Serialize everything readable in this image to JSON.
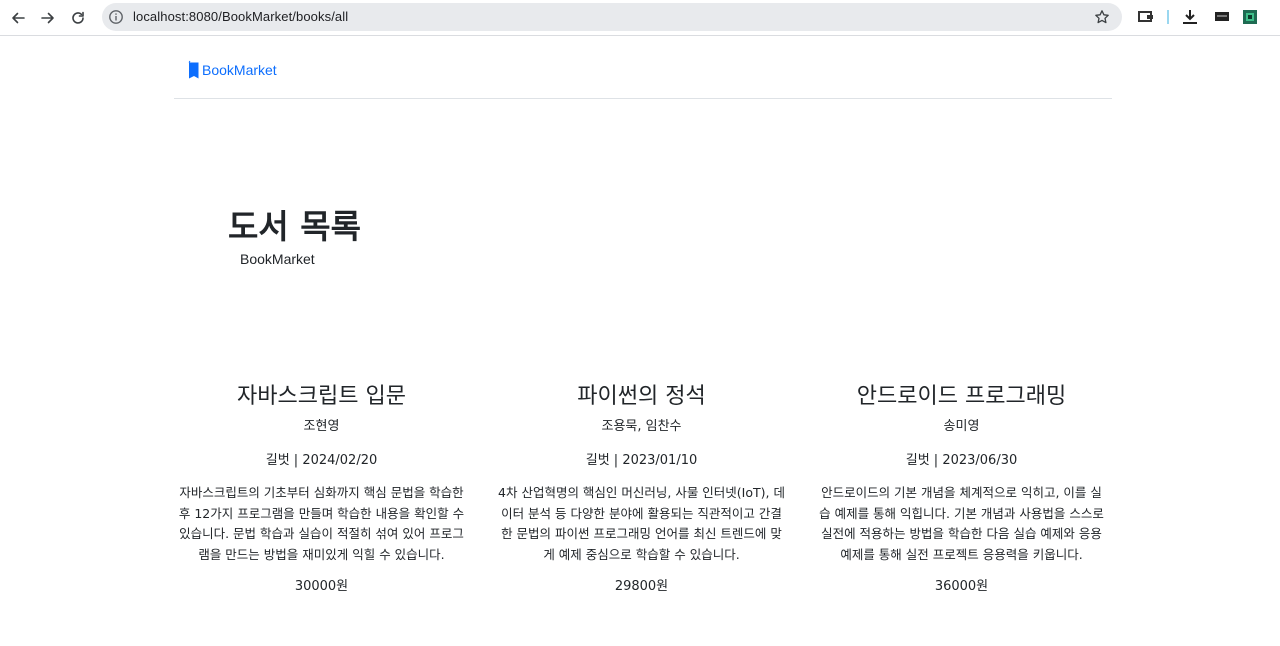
{
  "browser": {
    "url": "localhost:8080/BookMarket/books/all",
    "back_icon": "arrow-left-icon",
    "forward_icon": "arrow-right-icon",
    "reload_icon": "reload-icon",
    "star_icon": "star-outline-icon"
  },
  "navbar": {
    "brand": "BookMarket",
    "brand_icon": "book-icon"
  },
  "hero": {
    "title": "도서 목록",
    "subtitle": "BookMarket"
  },
  "books": [
    {
      "title": "자바스크립트 입문",
      "author": "조현영",
      "publisher_date": "길벗 | 2024/02/20",
      "description": "자바스크립트의 기초부터 심화까지 핵심 문법을 학습한 후 12가지 프로그램을 만들며 학습한 내용을 확인할 수 있습니다. 문법 학습과 실습이 적절히 섞여 있어 프로그램을 만드는 방법을 재미있게 익힐 수 있습니다.",
      "price": "30000원"
    },
    {
      "title": "파이썬의 정석",
      "author": "조용묵, 임찬수",
      "publisher_date": "길벗 | 2023/01/10",
      "description": "4차 산업혁명의 핵심인 머신러닝, 사물 인터넷(IoT), 데이터 분석 등 다양한 분야에 활용되는 직관적이고 간결한 문법의 파이썬 프로그래밍 언어를 최신 트렌드에 맞게 예제 중심으로 학습할 수 있습니다.",
      "price": "29800원"
    },
    {
      "title": "안드로이드 프로그래밍",
      "author": "송미영",
      "publisher_date": "길벗 | 2023/06/30",
      "description": "안드로이드의 기본 개념을 체계적으로 익히고, 이를 실습 예제를 통해 익힙니다. 기본 개념과 사용법을 스스로 실전에 적용하는 방법을 학습한 다음 실습 예제와 응용 예제를 통해 실전 프로젝트 응용력을 키웁니다.",
      "price": "36000원"
    }
  ]
}
